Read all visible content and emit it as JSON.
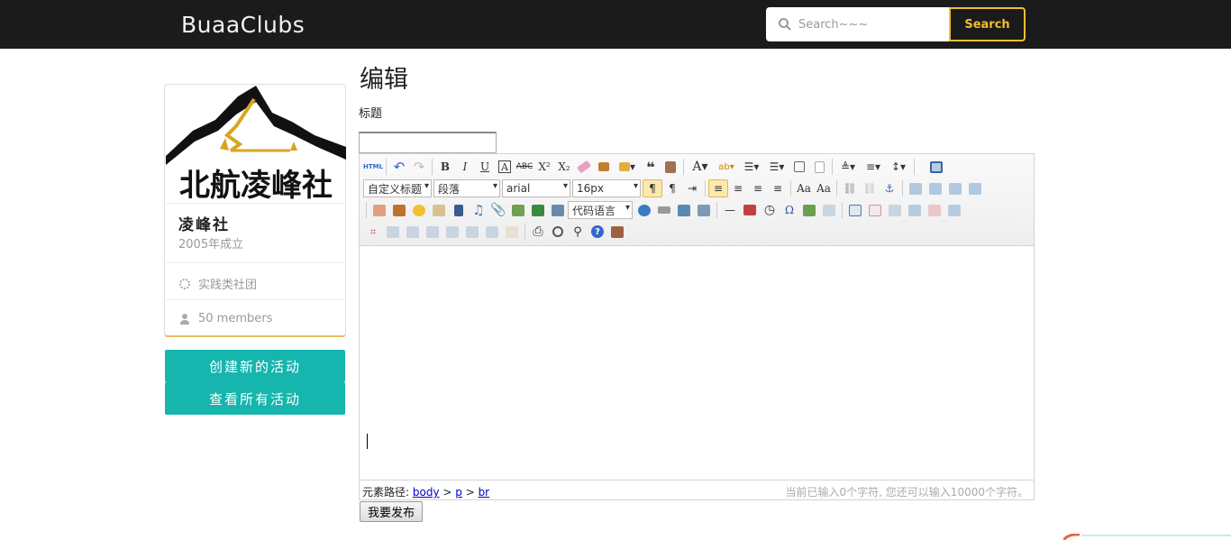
{
  "navbar": {
    "brand": "BuaaClubs",
    "search_placeholder": "Search~~~",
    "search_button": "Search"
  },
  "club": {
    "name": "凌峰社",
    "logo_text": "北航凌峰社",
    "founded": "2005年成立",
    "category": "实践类社团",
    "members": "50 members"
  },
  "sidebar_buttons": {
    "create": "创建新的活动",
    "view_all": "查看所有活动"
  },
  "form": {
    "page_title": "编辑",
    "title_label": "标题",
    "title_value": ""
  },
  "editor": {
    "html_btn": "HTML",
    "selects": {
      "custom_title": "自定义标题",
      "paragraph": "段落",
      "font": "arial",
      "size": "16px",
      "code_lang": "代码语言"
    },
    "path_label": "元素路径:",
    "path": [
      "body",
      "p",
      "br"
    ],
    "word_count": "当前已输入0个字符, 您还可以输入10000个字符。"
  },
  "submit_button": "我要发布",
  "colors": {
    "navbar_bg": "#1b1b1b",
    "accent_yellow": "#f0c02e",
    "teal": "#16b5ae"
  }
}
